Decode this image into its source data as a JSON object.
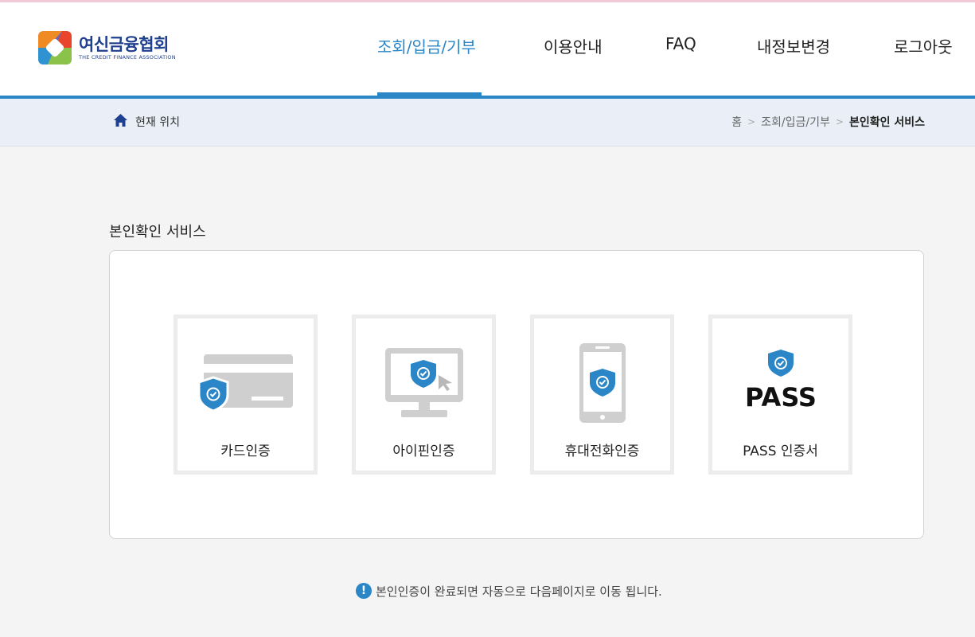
{
  "header": {
    "logo_ko": "여신금융협회",
    "logo_en": "THE CREDIT FINANCE ASSOCIATION",
    "nav": [
      {
        "label": "조회/입금/기부",
        "active": true
      },
      {
        "label": "이용안내",
        "active": false
      },
      {
        "label": "FAQ",
        "active": false
      },
      {
        "label": "내정보변경",
        "active": false
      },
      {
        "label": "로그아웃",
        "active": false
      }
    ]
  },
  "location": {
    "label": "현재 위치",
    "crumbs": [
      "홈",
      "조회/입금/기부",
      "본인확인 서비스"
    ],
    "separator": ">"
  },
  "main": {
    "title": "본인확인 서비스",
    "options": [
      {
        "label": "카드인증",
        "icon": "credit-card-shield-icon"
      },
      {
        "label": "아이핀인증",
        "icon": "monitor-shield-icon"
      },
      {
        "label": "휴대전화인증",
        "icon": "mobile-phone-shield-icon"
      },
      {
        "label": "PASS 인증서",
        "icon": "pass-shield-icon",
        "logo_text": "PASS"
      }
    ],
    "notice": "본인인증이 완료되면 자동으로 다음페이지로 이동 됩니다.",
    "notice_mark": "!"
  },
  "colors": {
    "accent": "#2a86c6",
    "brand": "#1f3f8f",
    "icon_gray": "#cfcfcf",
    "tile_border": "#ececec"
  }
}
